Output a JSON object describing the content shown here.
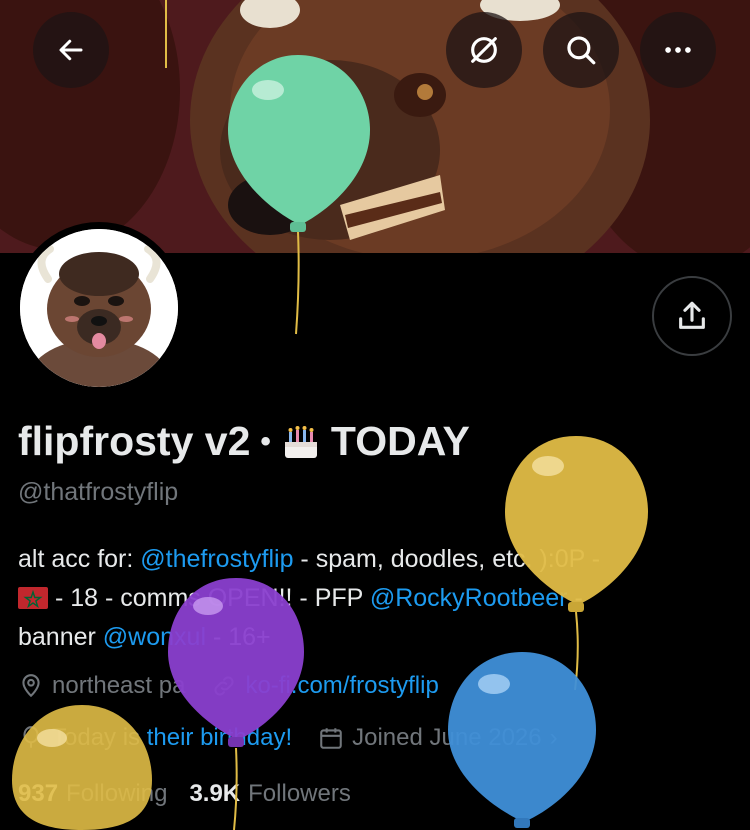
{
  "profile": {
    "display_name": "flipfrosty v2",
    "name_separator": "•",
    "birthday_icon": "birthday-cake-icon",
    "birthday_label": "TODAY",
    "handle": "@thatfrostyflip"
  },
  "bio": {
    "part1": "alt acc for: ",
    "mention1": "@thefrostyflip",
    "part2": " - spam, doodles, etc. ):0P -",
    "flag_icon": "morocco-flag-icon",
    "part3": " - 18 - comms OPEN!! - PFP ",
    "mention2": "@RockyRootbeer",
    "part4": " -",
    "part5": "banner ",
    "mention3": "@wonxul",
    "part6": " - 16+"
  },
  "meta": {
    "location": "northeast pa",
    "website": "ko-fi.com/frostyflip",
    "birthday_text_plain": "Today is ",
    "birthday_text_link": "their birthday!",
    "joined": "Joined June 2026"
  },
  "stats": {
    "following_count": "937",
    "following_label": "Following",
    "followers_count": "3.9K",
    "followers_label": "Followers"
  },
  "header_buttons": [
    "back-arrow-icon",
    "not-following-icon",
    "search-icon",
    "more-icon"
  ],
  "colors": {
    "background": "#000000",
    "text": "#e7e9ea",
    "secondary": "#71767b",
    "link": "#1d9bf0",
    "balloon_green": "#6fd3a6",
    "balloon_yellow": "#e0bc46",
    "balloon_purple": "#8a3fcf",
    "balloon_blue": "#3f8fd8"
  }
}
